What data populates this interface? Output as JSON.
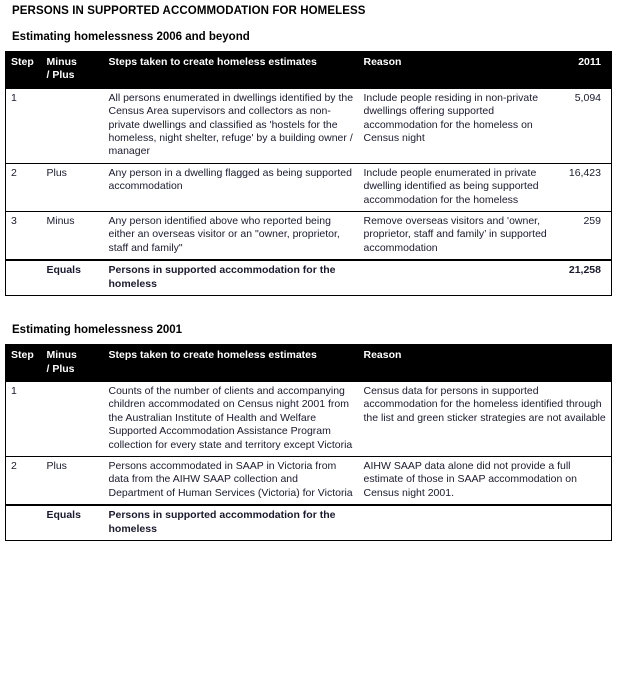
{
  "document": {
    "title": "PERSONS IN SUPPORTED ACCOMMODATION FOR HOMELESS"
  },
  "sections": [
    {
      "heading": "Estimating homelessness 2006 and beyond",
      "table": {
        "columns": [
          "Step",
          "Minus / Plus",
          "Steps taken to create homeless estimates",
          "Reason",
          "2011"
        ],
        "header_step": "Step",
        "header_sign_line1": "Minus",
        "header_sign_line2": "/ Plus",
        "header_steps": "Steps taken to create homeless estimates",
        "header_reason": "Reason",
        "header_year": "2011",
        "rows": [
          {
            "step": "1",
            "sign": "",
            "steps": "All persons enumerated in dwellings identified by the Census Area supervisors and collectors as non-private dwellings and classified as 'hostels for the homeless, night shelter, refuge' by a building owner / manager",
            "reason": "Include people residing in non-private dwellings offering supported accommodation for the homeless on Census night",
            "value": "5,094"
          },
          {
            "step": "2",
            "sign": "Plus",
            "steps": "Any person in a dwelling flagged as being supported accommodation",
            "reason": "Include people enumerated in private dwelling identified as being supported accommodation for the homeless",
            "value": "16,423"
          },
          {
            "step": "3",
            "sign": "Minus",
            "steps": "Any person identified above who reported being either an overseas visitor or an \"owner, proprietor, staff and family\"",
            "reason": "Remove overseas visitors and 'owner, proprietor, staff and family’ in supported accommodation",
            "value": "259"
          },
          {
            "step": "",
            "sign": "Equals",
            "steps": "Persons in supported accommodation for the homeless",
            "reason": "",
            "value": "21,258"
          }
        ]
      }
    },
    {
      "heading": "Estimating homelessness 2001",
      "table": {
        "columns": [
          "Step",
          "Minus / Plus",
          "Steps taken to create homeless estimates",
          "Reason"
        ],
        "header_step": "Step",
        "header_sign_line1": "Minus",
        "header_sign_line2": "/ Plus",
        "header_steps": "Steps taken to create homeless estimates",
        "header_reason": "Reason",
        "rows": [
          {
            "step": "1",
            "sign": "",
            "steps": "Counts of the number of clients and accompanying children accommodated on Census night 2001 from the Australian Institute of Health and Welfare Supported Accommodation Assistance Program collection for every state and territory except Victoria",
            "reason": "Census data for persons in supported accommodation for the homeless identified through the list and green sticker strategies are not available"
          },
          {
            "step": "2",
            "sign": "Plus",
            "steps": "Persons accommodated in SAAP in Victoria from data from the AIHW SAAP collection and Department of Human Services (Victoria) for Victoria",
            "reason": "AIHW SAAP data alone did not provide a full estimate of those in SAAP accommodation on Census night 2001."
          },
          {
            "step": "",
            "sign": "Equals",
            "steps": "Persons in supported accommodation for the homeless",
            "reason": ""
          }
        ]
      }
    }
  ],
  "colors": {
    "header_background": "#000000",
    "header_text": "#ffffff",
    "body_text": "#1a1a2e",
    "border": "#000000",
    "page_background": "#ffffff"
  }
}
